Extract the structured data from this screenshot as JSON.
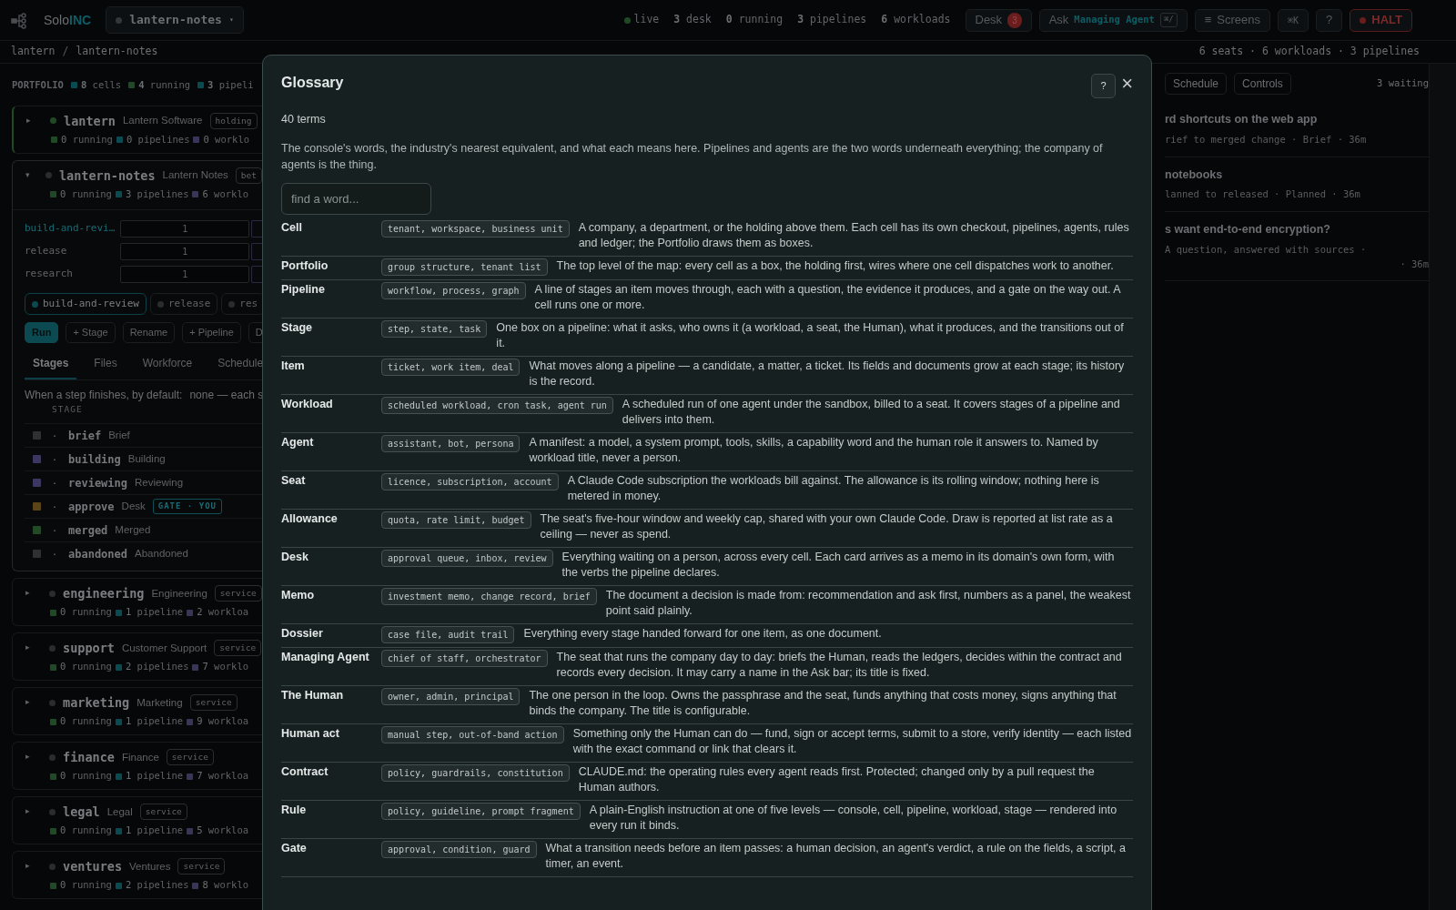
{
  "topbar": {
    "brand_prefix": "Solo",
    "brand_suffix": "INC",
    "project": {
      "name": "lantern-notes",
      "caret": "▾"
    },
    "live": "live",
    "counts": [
      {
        "count": "3",
        "label": "desk"
      },
      {
        "count": "0",
        "label": "running"
      },
      {
        "count": "3",
        "label": "pipelines"
      },
      {
        "count": "6",
        "label": "workloads"
      }
    ],
    "desk_button": {
      "label": "Desk",
      "badge": "3"
    },
    "ask_button": {
      "label": "Ask",
      "agent": "Managing Agent",
      "key": "⌘/"
    },
    "screens_button": {
      "icon": "≡",
      "label": "Screens"
    },
    "shortcut_button": "⌘K",
    "help_button": "?",
    "halt_button": "HALT"
  },
  "breadcrumb": {
    "items": [
      "lantern",
      "lantern-notes"
    ],
    "separator": "/",
    "summary": "6 seats · 6 workloads · 3 pipelines"
  },
  "portfolio": {
    "label": "PORTFOLIO",
    "stats": [
      {
        "count": "8",
        "label": "cells",
        "color": "#0b4a50"
      },
      {
        "count": "4",
        "label": "running",
        "color": "#1f4a25"
      },
      {
        "count": "3",
        "label": "pipeli",
        "color": "#0b4a50"
      }
    ]
  },
  "cells": [
    {
      "caret": "▸",
      "name": "lantern",
      "title": "Lantern Software",
      "tag": "holding",
      "live": true,
      "expanded": false,
      "stats": [
        {
          "count": "0",
          "label": "running",
          "color": "#1f4a25"
        },
        {
          "count": "0",
          "label": "pipelines",
          "color": "#0b4a50"
        },
        {
          "count": "0",
          "label": "worklo",
          "color": "#3a3458"
        }
      ]
    },
    {
      "caret": "▾",
      "name": "lantern-notes",
      "title": "Lantern Notes",
      "tag": "bet",
      "live": false,
      "expanded": true,
      "stats": [
        {
          "count": "0",
          "label": "running",
          "color": "#1f4a25"
        },
        {
          "count": "3",
          "label": "pipelines",
          "color": "#0b4a50"
        },
        {
          "count": "6",
          "label": "worklo",
          "color": "#3a3458"
        }
      ],
      "details": {
        "pipelines": [
          {
            "name": "build-and-revi…",
            "value": "1",
            "selected": true
          },
          {
            "name": "release",
            "value": "1",
            "selected": false
          },
          {
            "name": "research",
            "value": "1",
            "selected": false
          }
        ],
        "chips": [
          {
            "label": "build-and-review",
            "selected": true
          },
          {
            "label": "release",
            "selected": false
          },
          {
            "label": "res",
            "selected": false
          }
        ],
        "actions": [
          {
            "label": "Run",
            "kind": "primary"
          },
          {
            "label": "+ Stage",
            "kind": "plain"
          },
          {
            "label": "Rename",
            "kind": "plain"
          },
          {
            "label": "+ Pipeline",
            "kind": "plain"
          },
          {
            "label": "D",
            "kind": "plain"
          }
        ],
        "tabs": [
          {
            "label": "Stages",
            "selected": true
          },
          {
            "label": "Files",
            "selected": false
          },
          {
            "label": "Workforce",
            "selected": false
          },
          {
            "label": "Schedule",
            "selected": false
          }
        ],
        "default_label": "When a step finishes, by default:",
        "default_value": "none — each s",
        "stage_header": "STAGE",
        "stages": [
          {
            "handle": "·",
            "name": "brief",
            "label": "Brief",
            "color": "#2e3032"
          },
          {
            "handle": "·",
            "name": "building",
            "label": "Building",
            "color": "#3c3660"
          },
          {
            "handle": "·",
            "name": "reviewing",
            "label": "Reviewing",
            "color": "#3c3660"
          },
          {
            "handle": "·",
            "name": "approve",
            "label": "Desk",
            "color": "#5a4418",
            "gate": "GATE · YOU"
          },
          {
            "handle": "·",
            "name": "merged",
            "label": "Merged",
            "color": "#234a26"
          },
          {
            "handle": "·",
            "name": "abandoned",
            "label": "Abandoned",
            "color": "#2e3032"
          }
        ]
      }
    },
    {
      "caret": "▸",
      "name": "engineering",
      "title": "Engineering",
      "tag": "service",
      "live": false,
      "expanded": false,
      "stats": [
        {
          "count": "0",
          "label": "running",
          "color": "#1f4a25"
        },
        {
          "count": "1",
          "label": "pipeline",
          "color": "#0b4a50"
        },
        {
          "count": "2",
          "label": "workloa",
          "color": "#3a3458"
        }
      ]
    },
    {
      "caret": "▸",
      "name": "support",
      "title": "Customer Support",
      "tag": "service",
      "live": false,
      "expanded": false,
      "stats": [
        {
          "count": "0",
          "label": "running",
          "color": "#1f4a25"
        },
        {
          "count": "2",
          "label": "pipelines",
          "color": "#0b4a50"
        },
        {
          "count": "7",
          "label": "worklo",
          "color": "#3a3458"
        }
      ]
    },
    {
      "caret": "▸",
      "name": "marketing",
      "title": "Marketing",
      "tag": "service",
      "live": false,
      "expanded": false,
      "stats": [
        {
          "count": "0",
          "label": "running",
          "color": "#1f4a25"
        },
        {
          "count": "1",
          "label": "pipeline",
          "color": "#0b4a50"
        },
        {
          "count": "9",
          "label": "workloa",
          "color": "#3a3458"
        }
      ]
    },
    {
      "caret": "▸",
      "name": "finance",
      "title": "Finance",
      "tag": "service",
      "live": false,
      "expanded": false,
      "stats": [
        {
          "count": "0",
          "label": "running",
          "color": "#1f4a25"
        },
        {
          "count": "1",
          "label": "pipeline",
          "color": "#0b4a50"
        },
        {
          "count": "7",
          "label": "workloa",
          "color": "#3a3458"
        }
      ]
    },
    {
      "caret": "▸",
      "name": "legal",
      "title": "Legal",
      "tag": "service",
      "live": false,
      "expanded": false,
      "stats": [
        {
          "count": "0",
          "label": "running",
          "color": "#1f4a25"
        },
        {
          "count": "1",
          "label": "pipeline",
          "color": "#0b4a50"
        },
        {
          "count": "5",
          "label": "workloa",
          "color": "#3a3458"
        }
      ]
    },
    {
      "caret": "▸",
      "name": "ventures",
      "title": "Ventures",
      "tag": "service",
      "live": false,
      "expanded": false,
      "stats": [
        {
          "count": "0",
          "label": "running",
          "color": "#1f4a25"
        },
        {
          "count": "2",
          "label": "pipelines",
          "color": "#0b4a50"
        },
        {
          "count": "8",
          "label": "worklo",
          "color": "#3a3458"
        }
      ]
    }
  ],
  "queue": {
    "tabs": [
      "Schedule",
      "Controls"
    ],
    "waiting": "3 waiting",
    "items": [
      {
        "title": "rd shortcuts on the web app",
        "meta": "rief to merged change · Brief · 36m"
      },
      {
        "title": "notebooks",
        "meta": "lanned to released · Planned · 36m"
      },
      {
        "title": "s want end-to-end encryption?",
        "meta": "A question, answered with sources ·",
        "meta_end": "· 36m"
      }
    ]
  },
  "glossary": {
    "title": "Glossary",
    "help": "?",
    "close": "×",
    "count": "40 terms",
    "description": "The console's words, the industry's nearest equivalent, and what each means here. Pipelines and agents are the two words underneath everything; the company of agents is the thing.",
    "search": {
      "placeholder": "find a word..."
    },
    "terms": [
      {
        "term": "Cell",
        "synonyms": "tenant, workspace, business unit",
        "definition": "A company, a department, or the holding above them. Each cell has its own checkout, pipelines, agents, rules and ledger; the Portfolio draws them as boxes."
      },
      {
        "term": "Portfolio",
        "synonyms": "group structure, tenant list",
        "definition": "The top level of the map: every cell as a box, the holding first, wires where one cell dispatches work to another."
      },
      {
        "term": "Pipeline",
        "synonyms": "workflow, process, graph",
        "definition": "A line of stages an item moves through, each with a question, the evidence it produces, and a gate on the way out. A cell runs one or more."
      },
      {
        "term": "Stage",
        "synonyms": "step, state, task",
        "definition": "One box on a pipeline: what it asks, who owns it (a workload, a seat, the Human), what it produces, and the transitions out of it."
      },
      {
        "term": "Item",
        "synonyms": "ticket, work item, deal",
        "definition": "What moves along a pipeline — a candidate, a matter, a ticket. Its fields and documents grow at each stage; its history is the record."
      },
      {
        "term": "Workload",
        "synonyms": "scheduled workload, cron task, agent run",
        "definition": "A scheduled run of one agent under the sandbox, billed to a seat. It covers stages of a pipeline and delivers into them."
      },
      {
        "term": "Agent",
        "synonyms": "assistant, bot, persona",
        "definition": "A manifest: a model, a system prompt, tools, skills, a capability word and the human role it answers to. Named by workload title, never a person."
      },
      {
        "term": "Seat",
        "synonyms": "licence, subscription, account",
        "definition": "A Claude Code subscription the workloads bill against. The allowance is its rolling window; nothing here is metered in money."
      },
      {
        "term": "Allowance",
        "synonyms": "quota, rate limit, budget",
        "definition": "The seat's five-hour window and weekly cap, shared with your own Claude Code. Draw is reported at list rate as a ceiling — never as spend."
      },
      {
        "term": "Desk",
        "synonyms": "approval queue, inbox, review",
        "definition": "Everything waiting on a person, across every cell. Each card arrives as a memo in its domain's own form, with the verbs the pipeline declares."
      },
      {
        "term": "Memo",
        "synonyms": "investment memo, change record, brief",
        "definition": "The document a decision is made from: recommendation and ask first, numbers as a panel, the weakest point said plainly."
      },
      {
        "term": "Dossier",
        "synonyms": "case file, audit trail",
        "definition": "Everything every stage handed forward for one item, as one document."
      },
      {
        "term": "Managing Agent",
        "synonyms": "chief of staff, orchestrator",
        "definition": "The seat that runs the company day to day: briefs the Human, reads the ledgers, decides within the contract and records every decision. It may carry a name in the Ask bar; its title is fixed."
      },
      {
        "term": "The Human",
        "synonyms": "owner, admin, principal",
        "definition": "The one person in the loop. Owns the passphrase and the seat, funds anything that costs money, signs anything that binds the company. The title is configurable."
      },
      {
        "term": "Human act",
        "synonyms": "manual step, out-of-band action",
        "definition": "Something only the Human can do — fund, sign or accept terms, submit to a store, verify identity — each listed with the exact command or link that clears it."
      },
      {
        "term": "Contract",
        "synonyms": "policy, guardrails, constitution",
        "definition": "CLAUDE.md: the operating rules every agent reads first. Protected; changed only by a pull request the Human authors."
      },
      {
        "term": "Rule",
        "synonyms": "policy, guideline, prompt fragment",
        "definition": "A plain-English instruction at one of five levels — console, cell, pipeline, workload, stage — rendered into every run it binds."
      },
      {
        "term": "Gate",
        "synonyms": "approval, condition, guard",
        "definition": "What a transition needs before an item passes: a human decision, an agent's verdict, a rule on the fields, a script, a timer, an event."
      }
    ]
  }
}
